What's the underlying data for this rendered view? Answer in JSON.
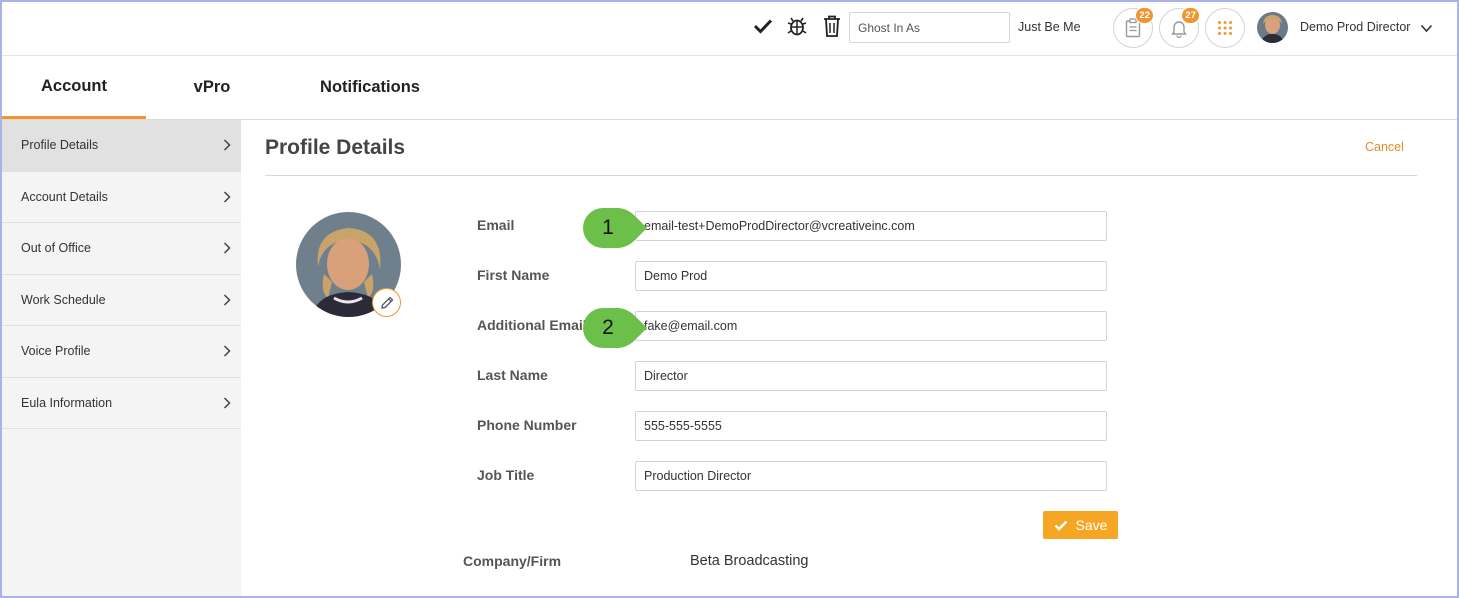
{
  "topbar": {
    "ghost_placeholder": "Ghost In As",
    "just_be_me": "Just Be Me",
    "tasks_badge": "22",
    "notifications_badge": "27",
    "user_name": "Demo Prod Director",
    "icons": [
      "check-icon",
      "bug-icon",
      "trash-icon",
      "clipboard-icon",
      "bell-icon",
      "apps-grid-icon",
      "chevron-down-icon"
    ]
  },
  "tabs": [
    {
      "label": "Account",
      "active": true
    },
    {
      "label": "vPro",
      "active": false
    },
    {
      "label": "Notifications",
      "active": false
    }
  ],
  "sidebar": {
    "items": [
      {
        "label": "Profile Details",
        "active": true
      },
      {
        "label": "Account Details",
        "active": false
      },
      {
        "label": "Out of Office",
        "active": false
      },
      {
        "label": "Work Schedule",
        "active": false
      },
      {
        "label": "Voice Profile",
        "active": false
      },
      {
        "label": "Eula Information",
        "active": false
      }
    ]
  },
  "main": {
    "title": "Profile Details",
    "cancel_label": "Cancel",
    "fields": [
      {
        "label": "Email",
        "value": "email-test+DemoProdDirector@vcreativeinc.com"
      },
      {
        "label": "First Name",
        "value": "Demo Prod"
      },
      {
        "label": "Additional Email",
        "value": "fake@email.com"
      },
      {
        "label": "Last Name",
        "value": "Director"
      },
      {
        "label": "Phone Number",
        "value": "555-555-5555"
      },
      {
        "label": "Job Title",
        "value": "Production Director"
      }
    ],
    "save_label": "Save",
    "company_label": "Company/Firm",
    "company_value": "Beta Broadcasting"
  },
  "callouts": [
    {
      "number": "1"
    },
    {
      "number": "2"
    }
  ],
  "colors": {
    "accent": "#f0962e",
    "save_button": "#f5a623",
    "callout": "#6cc04a"
  }
}
